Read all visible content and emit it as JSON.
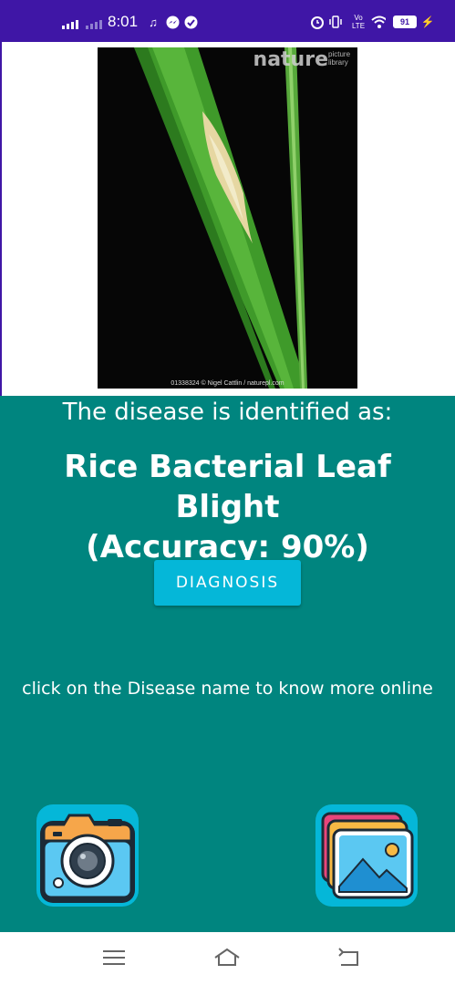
{
  "status_bar": {
    "time": "8:01",
    "battery": "91",
    "volte": "Vo LTE",
    "background": "#3f16a6"
  },
  "photo": {
    "watermark_brand": "nature",
    "watermark_sub": "picture library",
    "caption": "01338324 © Nigel Cattlin / naturepl.com"
  },
  "result": {
    "subtitle": "The disease is identified as:",
    "disease_line1": "Rice Bacterial Leaf Blight",
    "disease_line2": "(Accuracy: 90%)"
  },
  "diagnosis_button": {
    "label": "DIAGNOSIS"
  },
  "hint": "click on the Disease name to know more online",
  "colors": {
    "panel": "#00857f",
    "accent": "#05b7d8",
    "camera_body": "#5bc8f2",
    "camera_top": "#f6a64a"
  },
  "icons": {
    "camera": "camera-icon",
    "gallery": "gallery-icon",
    "nav_menu": "menu-icon",
    "nav_home": "home-icon",
    "nav_back": "back-icon"
  }
}
